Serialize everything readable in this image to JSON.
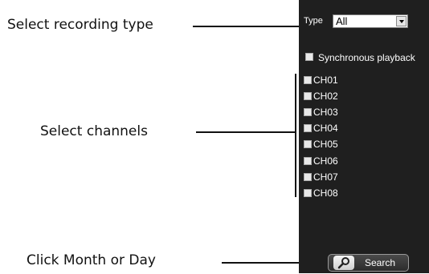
{
  "callouts": {
    "recording_type": "Select recording type",
    "channels": "Select channels",
    "month_day": "Click Month or Day"
  },
  "panel": {
    "type_label": "Type",
    "type_selected": "All",
    "sync_label": "Synchronous playback",
    "channels": [
      "CH01",
      "CH02",
      "CH03",
      "CH04",
      "CH05",
      "CH06",
      "CH07",
      "CH08"
    ],
    "search_label": "Search"
  },
  "colors": {
    "panel_bg": "#1f1f1f",
    "callout_text": "#111111"
  },
  "icons": [
    "search-icon",
    "chevron-down-icon",
    "checkbox"
  ]
}
